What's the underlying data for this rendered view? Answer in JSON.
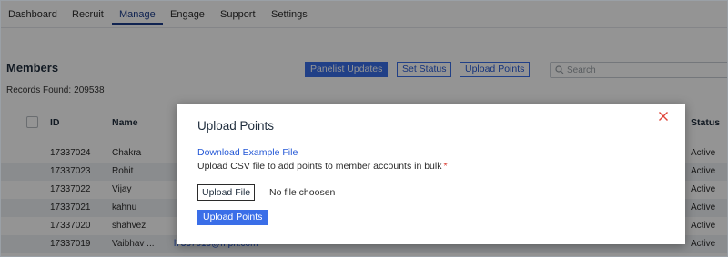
{
  "nav": {
    "items": [
      "Dashboard",
      "Recruit",
      "Manage",
      "Engage",
      "Support",
      "Settings"
    ],
    "active": "Manage"
  },
  "members": {
    "title": "Members",
    "records_label": "Records Found:",
    "records_count": "209538",
    "actions": {
      "panelist_updates": "Panelist Updates",
      "set_status": "Set Status",
      "upload_points": "Upload Points"
    },
    "search_placeholder": "Search"
  },
  "table": {
    "headers": {
      "id": "ID",
      "name": "Name",
      "status": "Status"
    },
    "rows": [
      {
        "id": "17337024",
        "name": "Chakra",
        "status": "Active"
      },
      {
        "id": "17337023",
        "name": "Rohit",
        "status": "Active"
      },
      {
        "id": "17337022",
        "name": "Vijay",
        "status": "Active"
      },
      {
        "id": "17337021",
        "name": "kahnu",
        "status": "Active"
      },
      {
        "id": "17337020",
        "name": "shahvez",
        "status": "Active"
      },
      {
        "id": "17337019",
        "name": "Vaibhav ...",
        "status": "Active",
        "email": "l7337019@mpn.com"
      }
    ]
  },
  "modal": {
    "title": "Upload Points",
    "download_link": "Download Example File",
    "description": "Upload CSV file to add points to member accounts in bulk",
    "required_mark": "*",
    "file_button": "Upload File",
    "file_status": "No file choosen",
    "submit": "Upload Points"
  },
  "colors": {
    "primary": "#3a6ee8",
    "link": "#2458d6",
    "nav_active": "#1c3d8c",
    "close": "#e0453a",
    "required": "#d93025"
  }
}
